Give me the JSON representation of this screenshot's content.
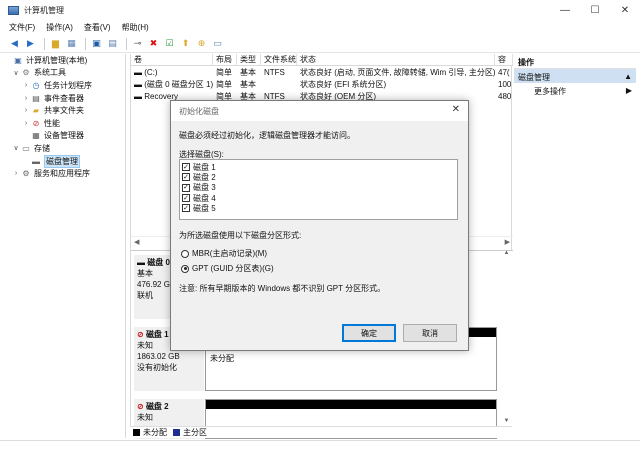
{
  "window": {
    "title": "计算机管理",
    "minimize": "—",
    "maximize": "☐",
    "close": "✕"
  },
  "menu": [
    "文件(F)",
    "操作(A)",
    "查看(V)",
    "帮助(H)"
  ],
  "tree": [
    {
      "label": "计算机管理(本地)",
      "indent": 0,
      "caret": ""
    },
    {
      "label": "系统工具",
      "indent": 1,
      "caret": "∨"
    },
    {
      "label": "任务计划程序",
      "indent": 2,
      "caret": "›"
    },
    {
      "label": "事件查看器",
      "indent": 2,
      "caret": "›"
    },
    {
      "label": "共享文件夹",
      "indent": 2,
      "caret": "›"
    },
    {
      "label": "性能",
      "indent": 2,
      "caret": "›"
    },
    {
      "label": "设备管理器",
      "indent": 2,
      "caret": ""
    },
    {
      "label": "存储",
      "indent": 1,
      "caret": "∨"
    },
    {
      "label": "磁盘管理",
      "indent": 2,
      "caret": "",
      "selected": true
    },
    {
      "label": "服务和应用程序",
      "indent": 1,
      "caret": "›"
    }
  ],
  "columns": [
    "卷",
    "布局",
    "类型",
    "文件系统",
    "状态",
    "容"
  ],
  "volumes": [
    [
      "(C:)",
      "简单",
      "基本",
      "NTFS",
      "状态良好 (启动, 页面文件, 故障转储, Wim 引导, 主分区)",
      "47("
    ],
    [
      "(磁盘 0 磁盘分区 1)",
      "简单",
      "基本",
      "",
      "状态良好 (EFI 系统分区)",
      "100"
    ],
    [
      "Recovery",
      "简单",
      "基本",
      "NTFS",
      "状态良好 (OEM 分区)",
      "480"
    ]
  ],
  "disks": [
    {
      "name": "磁盘 0",
      "type": "基本",
      "size": "476.92 GB",
      "status": "联机",
      "part_size": "",
      "part_status": ""
    },
    {
      "name": "磁盘 1",
      "type": "未知",
      "size": "1863.02 GB",
      "status": "没有初始化",
      "part_size": "1863.02 GB",
      "part_status": "未分配"
    },
    {
      "name": "磁盘 2",
      "type": "未知",
      "size": "",
      "status": "",
      "part_size": "",
      "part_status": ""
    }
  ],
  "legend": [
    {
      "label": "未分配",
      "color": "#000000"
    },
    {
      "label": "主分区",
      "color": "#1f2f8f"
    }
  ],
  "actions": {
    "header": "操作",
    "section": "磁盘管理",
    "more": "更多操作"
  },
  "dialog": {
    "title": "初始化磁盘",
    "intro": "磁盘必须经过初始化，逻辑磁盘管理器才能访问。",
    "select_label": "选择磁盘(S):",
    "disks": [
      "磁盘 1",
      "磁盘 2",
      "磁盘 3",
      "磁盘 4",
      "磁盘 5"
    ],
    "style_label": "为所选磁盘使用以下磁盘分区形式:",
    "options": [
      {
        "label": "MBR(主启动记录)(M)",
        "checked": false
      },
      {
        "label": "GPT (GUID 分区表)(G)",
        "checked": true
      }
    ],
    "note": "注意: 所有早期版本的 Windows 都不识别 GPT 分区形式。",
    "ok": "确定",
    "cancel": "取消"
  }
}
